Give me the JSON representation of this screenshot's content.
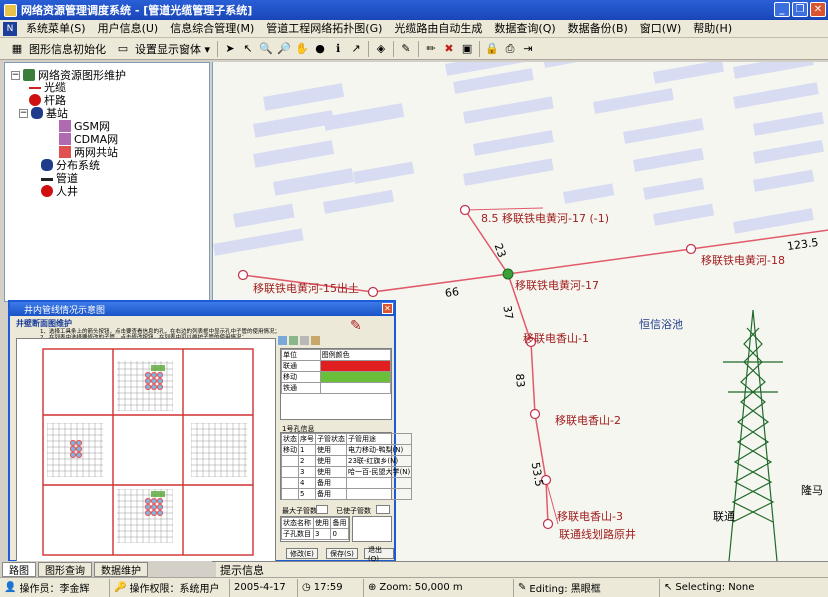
{
  "window": {
    "title": "网络资源管理调度系统 - [管道光缆管理子系统]"
  },
  "menu": [
    "系统菜单(S)",
    "用户信息(U)",
    "信息综合管理(M)",
    "管道工程网络拓扑图(G)",
    "光缆路由自动生成",
    "数据查询(Q)",
    "数据备份(B)",
    "窗口(W)",
    "帮助(H)"
  ],
  "toolbar": {
    "init_label": "图形信息初始化",
    "display_label": "设置显示窗体 ▾"
  },
  "tree": {
    "root": "网络资源图形维护",
    "items": [
      "光缆",
      "杆路",
      "基站",
      "GSM网",
      "CDMA网",
      "两网共站",
      "分布系统",
      "管道",
      "人井"
    ]
  },
  "map": {
    "labels": [
      "8.5 移联铁电黄河-17 (-1)",
      "移联铁电黄河-17",
      "移联铁电黄河-18",
      "移联铁电黄河-15出土",
      "移联电香山-1",
      "移联电香山-2",
      "移联电香山-3",
      "联通线划路原井",
      "恒信浴池",
      "联通",
      "隆马"
    ],
    "segments": [
      "23",
      "66",
      "37",
      "83",
      "53.5",
      "123.5"
    ]
  },
  "dialog": {
    "title": "井内管线情况示意图",
    "subtitle": "井壁断面图维护",
    "hint1": "1、选择工具条上的箭头按钮，点击要查看信息的孔，在右边的列表框中显示孔中子管的使用情况；",
    "hint2": "2、在列表中选择要修改的子管，点击修改按钮，在列表中可以维护子管的使用情况；",
    "legend_headers": [
      "单位",
      "图例颜色"
    ],
    "legend_rows": [
      "联通",
      "移动",
      "铁通"
    ],
    "legend_colors": [
      "#e02020",
      "#6abf3a",
      "#ffffff"
    ],
    "pipe_title": "1号孔信息",
    "pipe_headers": [
      "状态",
      "序号",
      "子管状态",
      "子管用途"
    ],
    "pipe_rows": [
      [
        "移动",
        "1",
        "使用",
        "电力移动-鸭梨(N)"
      ],
      [
        "",
        "2",
        "使用",
        "23联-红旗乡(N)"
      ],
      [
        "",
        "3",
        "使用",
        "哈一百-民盟大学(N)"
      ],
      [
        "",
        "4",
        "备用",
        ""
      ],
      [
        "",
        "5",
        "备用",
        ""
      ]
    ],
    "max_label": "最大子管数",
    "used_label": "已使子管数",
    "count_headers": [
      "状态名称",
      "使用",
      "备用"
    ],
    "count_row": [
      "子孔数目",
      "3",
      "0"
    ],
    "buttons": [
      "修改(E)",
      "保存(S)",
      "退出(Q)"
    ]
  },
  "bottom_tabs": [
    "路图",
    "图形查询",
    "数据维护"
  ],
  "hint": "提示信息",
  "status": {
    "operator": "操作员：李金辉",
    "permission": "操作权限：系统用户",
    "date": "2005-4-17",
    "time": "17:59",
    "zoom": "Zoom: 50,000 m",
    "editing": "Editing: 黑眼框",
    "selecting": "Selecting: None"
  }
}
